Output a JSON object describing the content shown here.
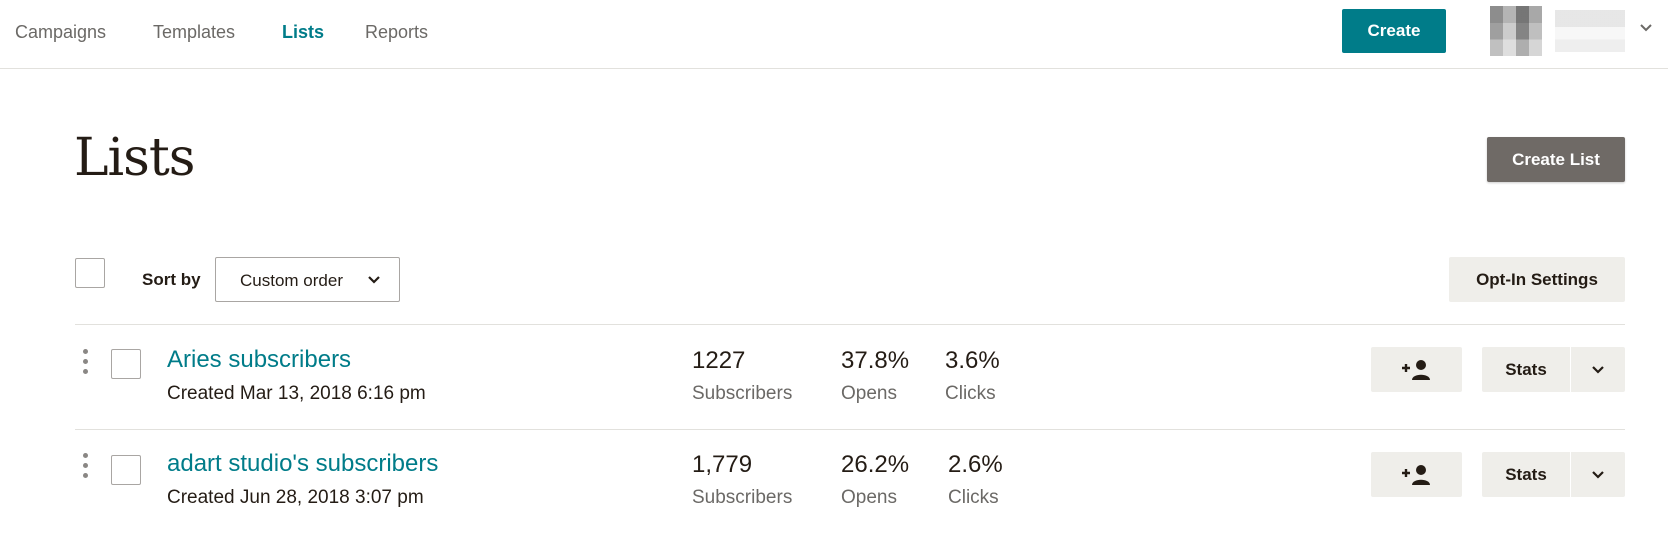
{
  "nav": {
    "items": [
      {
        "label": "Campaigns",
        "active": false
      },
      {
        "label": "Templates",
        "active": false
      },
      {
        "label": "Lists",
        "active": true
      },
      {
        "label": "Reports",
        "active": false
      }
    ],
    "create_label": "Create",
    "accent_color": "#007c89"
  },
  "page": {
    "title": "Lists",
    "create_list_label": "Create List"
  },
  "toolbar": {
    "sort_by_label": "Sort by",
    "sort_value": "Custom order",
    "opt_in_label": "Opt-In Settings"
  },
  "lists": [
    {
      "name": "Aries subscribers",
      "created": "Created Mar 13, 2018 6:16 pm",
      "subscribers": "1227",
      "subscribers_label": "Subscribers",
      "opens": "37.8%",
      "opens_label": "Opens",
      "clicks": "3.6%",
      "clicks_label": "Clicks",
      "stats_label": "Stats"
    },
    {
      "name": "adart studio's subscribers",
      "created": "Created Jun 28, 2018 3:07 pm",
      "subscribers": "1,779",
      "subscribers_label": "Subscribers",
      "opens": "26.2%",
      "opens_label": "Opens",
      "clicks": "2.6%",
      "clicks_label": "Clicks",
      "stats_label": "Stats"
    }
  ],
  "icons": {
    "add_subscriber": "add-user-icon",
    "more": "chevron-down-icon",
    "drag": "drag-handle-icon"
  }
}
